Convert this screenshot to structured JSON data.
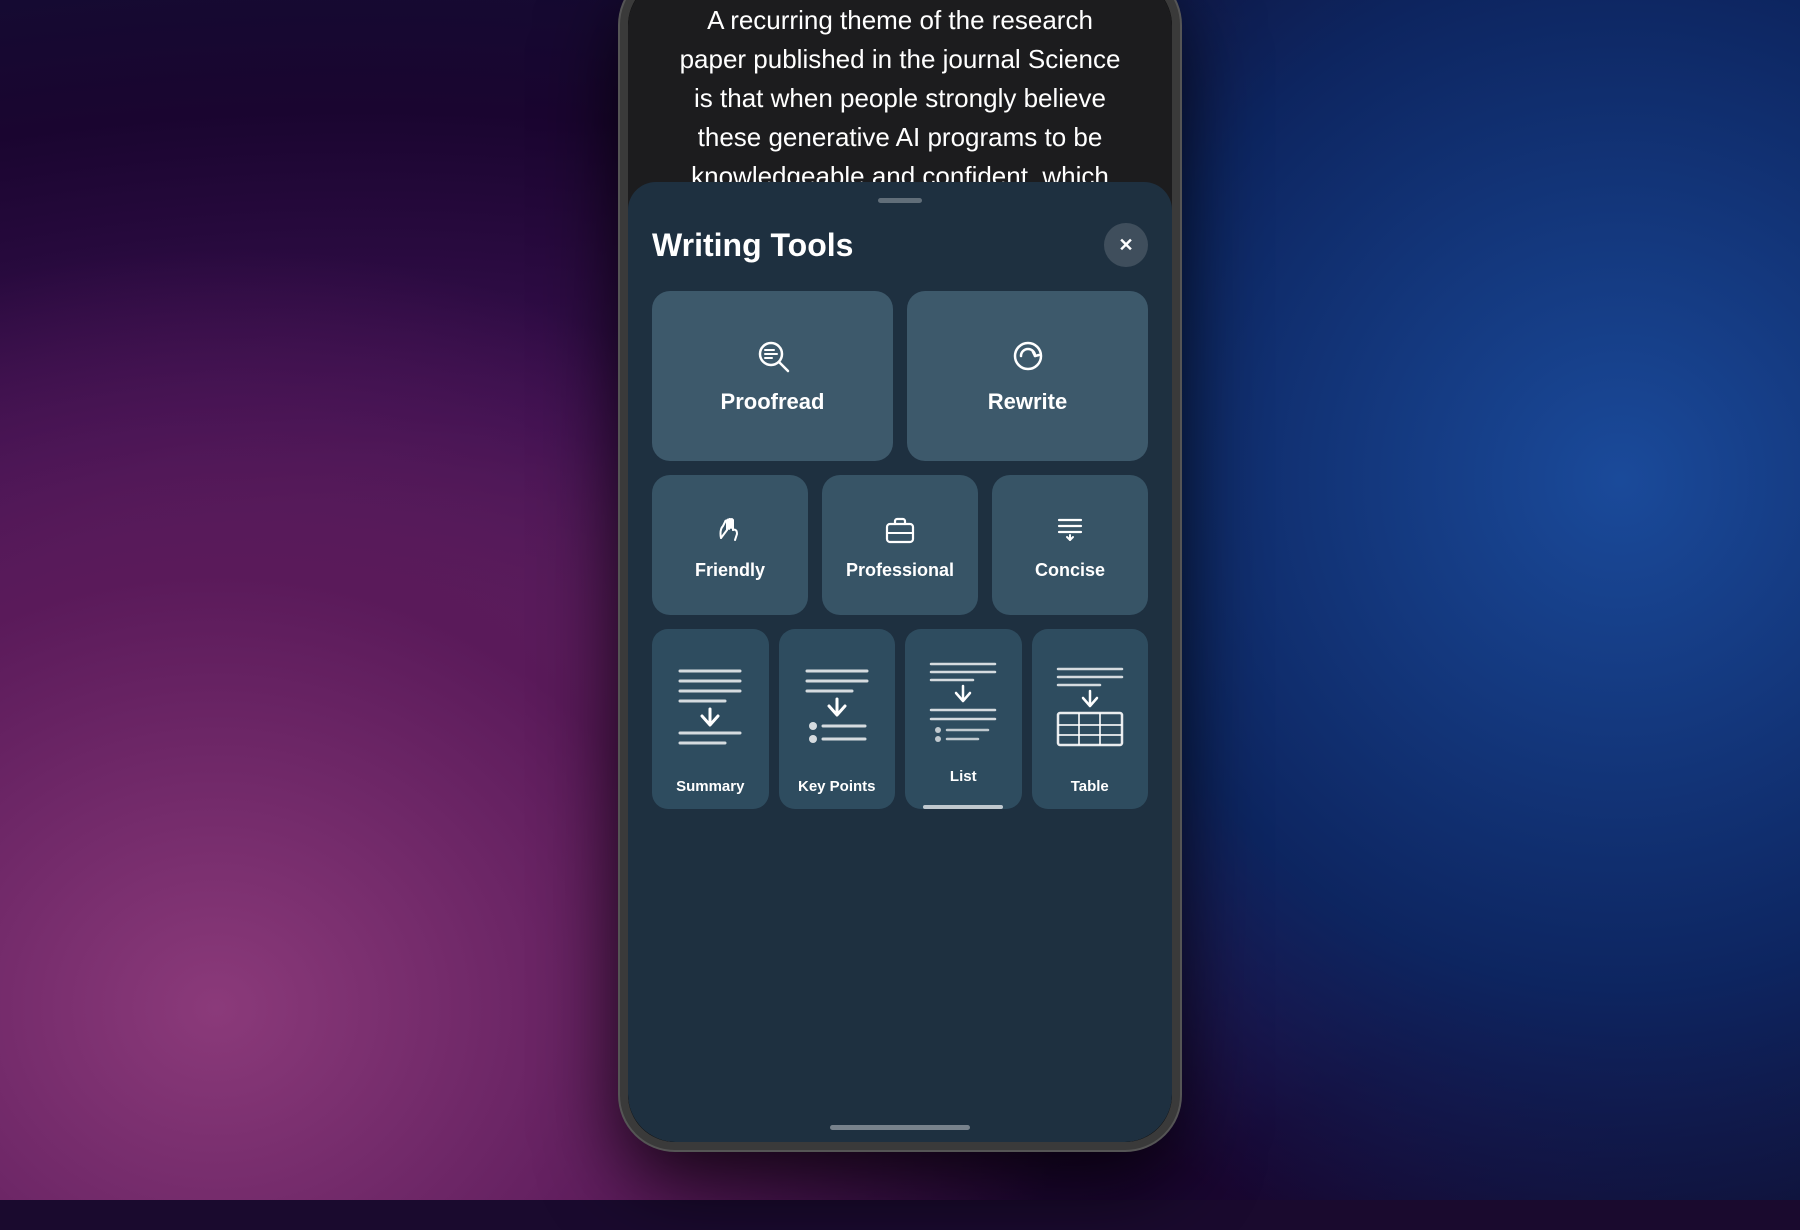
{
  "background": {
    "description": "Hand holding phone with purple/blue bokeh background"
  },
  "article": {
    "text": "A recurring theme of the research paper published in the journal Science is that when people strongly believe these generative AI programs to be knowledgeable and confident, which means they are more likely to put their"
  },
  "sheet": {
    "drag_handle": true,
    "title": "Writing Tools",
    "close_button_label": "✕"
  },
  "tools": {
    "row1": [
      {
        "id": "proofread",
        "label": "Proofread",
        "icon": "proofread"
      },
      {
        "id": "rewrite",
        "label": "Rewrite",
        "icon": "rewrite"
      }
    ],
    "row2": [
      {
        "id": "friendly",
        "label": "Friendly",
        "icon": "friendly"
      },
      {
        "id": "professional",
        "label": "Professional",
        "icon": "professional"
      },
      {
        "id": "concise",
        "label": "Concise",
        "icon": "concise"
      }
    ],
    "row3": [
      {
        "id": "summary",
        "label": "Summary",
        "icon": "summary"
      },
      {
        "id": "key-points",
        "label": "Key Points",
        "icon": "key-points"
      },
      {
        "id": "list",
        "label": "List",
        "icon": "list"
      },
      {
        "id": "table",
        "label": "Table",
        "icon": "table"
      }
    ]
  }
}
